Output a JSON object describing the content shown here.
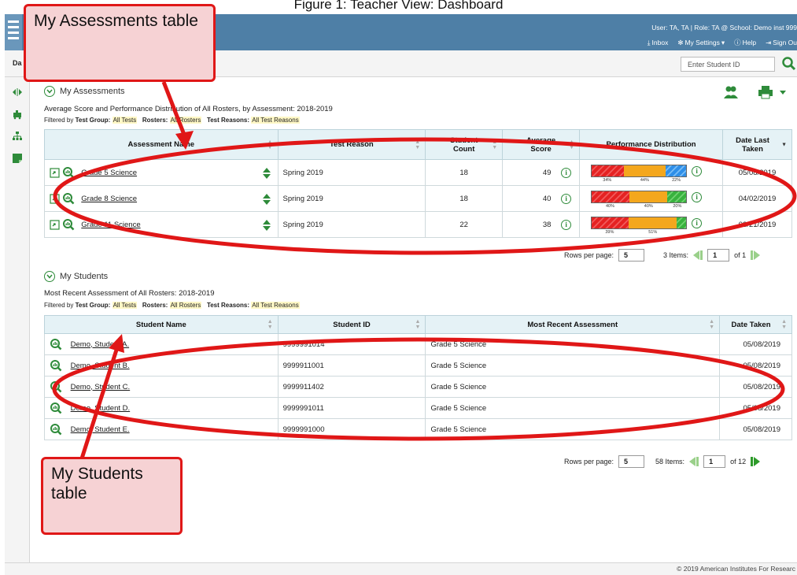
{
  "figure_caption": "Figure 1: Teacher View: Dashboard",
  "header": {
    "user_line": "User: TA, TA  |  Role: TA @ School: Demo inst 999",
    "inbox": "Inbox",
    "settings": "My Settings",
    "help": "Help",
    "sign_out": "Sign Ou"
  },
  "subheader": {
    "tab": "Da",
    "student_id_placeholder": "Enter Student ID"
  },
  "assessments": {
    "title": "My Assessments",
    "subtitle": "Average Score and Performance Distribution of All Rosters, by Assessment: 2018-2019",
    "filter": {
      "prefix": "Filtered by",
      "group_label": "Test Group:",
      "group_value": "All Tests",
      "rosters_label": "Rosters:",
      "rosters_value": "All Rosters",
      "reasons_label": "Test Reasons:",
      "reasons_value": "All Test Reasons"
    },
    "columns": [
      "Assessment Name",
      "Test Reason",
      "Student Count",
      "Average Score",
      "Performance Distribution",
      "Date Last Taken"
    ],
    "rows": [
      {
        "name": "Grade 5 Science",
        "reason": "Spring 2019",
        "count": "18",
        "score": "49",
        "dist": [
          34,
          44,
          22
        ],
        "dist_colors": [
          "red",
          "orange",
          "blue"
        ],
        "dist_labels": [
          "34%",
          "44%",
          "22%"
        ],
        "date": "05/08/2019"
      },
      {
        "name": "Grade 8 Science",
        "reason": "Spring 2019",
        "count": "18",
        "score": "40",
        "dist": [
          40,
          40,
          20
        ],
        "dist_colors": [
          "red",
          "orange",
          "green"
        ],
        "dist_labels": [
          "40%",
          "40%",
          "20%"
        ],
        "date": "04/02/2019"
      },
      {
        "name": "Grade 11 Science",
        "reason": "Spring 2019",
        "count": "22",
        "score": "38",
        "dist": [
          39,
          51,
          10
        ],
        "dist_colors": [
          "red",
          "orange",
          "green"
        ],
        "dist_labels": [
          "39%",
          "51%",
          ""
        ],
        "date": "03/21/2019"
      }
    ],
    "pager": {
      "rows_label": "Rows per page:",
      "rows_value": "5",
      "items": "3 Items:",
      "page": "1",
      "of": "of 1"
    }
  },
  "students": {
    "title": "My Students",
    "subtitle": "Most Recent Assessment of All Rosters: 2018-2019",
    "filter": {
      "prefix": "Filtered by",
      "group_label": "Test Group:",
      "group_value": "All Tests",
      "rosters_label": "Rosters:",
      "rosters_value": "All Rosters",
      "reasons_label": "Test Reasons:",
      "reasons_value": "All Test Reasons"
    },
    "columns": [
      "Student Name",
      "Student ID",
      "Most Recent Assessment",
      "Date Taken"
    ],
    "rows": [
      {
        "name": "Demo, Student A.",
        "id": "9999991014",
        "assessment": "Grade 5 Science",
        "date": "05/08/2019"
      },
      {
        "name": "Demo, Student B.",
        "id": "9999911001",
        "assessment": "Grade 5 Science",
        "date": "05/08/2019"
      },
      {
        "name": "Demo, Student C.",
        "id": "9999911402",
        "assessment": "Grade 5 Science",
        "date": "05/08/2019"
      },
      {
        "name": "Demo, Student D.",
        "id": "9999991011",
        "assessment": "Grade 5 Science",
        "date": "05/08/2019"
      },
      {
        "name": "Demo, Student E.",
        "id": "9999991000",
        "assessment": "Grade 5 Science",
        "date": "05/08/2019"
      }
    ],
    "pager": {
      "rows_label": "Rows per page:",
      "rows_value": "5",
      "items": "58 Items:",
      "page": "1",
      "of": "of 12"
    }
  },
  "footer": "© 2019 American Institutes For Researc",
  "callouts": {
    "assessments": "My Assessments table",
    "students": "My Students table"
  },
  "colors": {
    "header": "#4e7fa6",
    "accent_green": "#2e8b3a",
    "callout_red": "#e01717",
    "callout_fill": "#f6d2d4"
  }
}
